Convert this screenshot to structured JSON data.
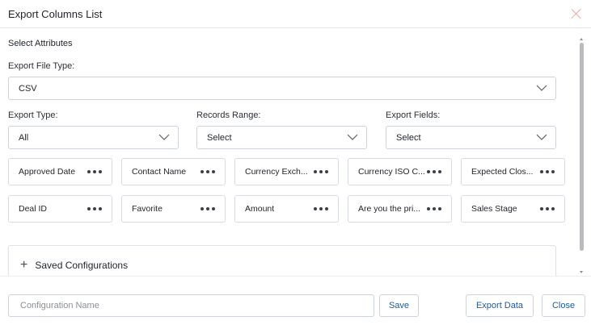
{
  "header": {
    "title": "Export Columns List"
  },
  "section_title": "Select Attributes",
  "export_file_type": {
    "label": "Export File Type:",
    "value": "CSV"
  },
  "export_type": {
    "label": "Export Type:",
    "value": "All"
  },
  "records_range": {
    "label": "Records Range:",
    "value": "Select"
  },
  "export_fields": {
    "label": "Export Fields:",
    "value": "Select"
  },
  "columns": [
    {
      "label": "Approved Date"
    },
    {
      "label": "Contact Name"
    },
    {
      "label": "Currency Exch..."
    },
    {
      "label": "Currency ISO C..."
    },
    {
      "label": "Expected Clos..."
    },
    {
      "label": "Deal ID"
    },
    {
      "label": "Favorite"
    },
    {
      "label": "Amount"
    },
    {
      "label": "Are you the pri..."
    },
    {
      "label": "Sales Stage"
    }
  ],
  "saved_configurations": {
    "label": "Saved Configurations"
  },
  "footer": {
    "config_name_placeholder": "Configuration Name",
    "config_name_value": "",
    "save_label": "Save",
    "export_label": "Export Data",
    "close_label": "Close"
  },
  "colors": {
    "accent_text": "#1e5a96",
    "close_icon": "#f2a3a3",
    "border": "#cfd4da"
  },
  "icons": [
    "close-icon",
    "chevron-down-icon",
    "more-dots-icon",
    "plus-icon"
  ]
}
